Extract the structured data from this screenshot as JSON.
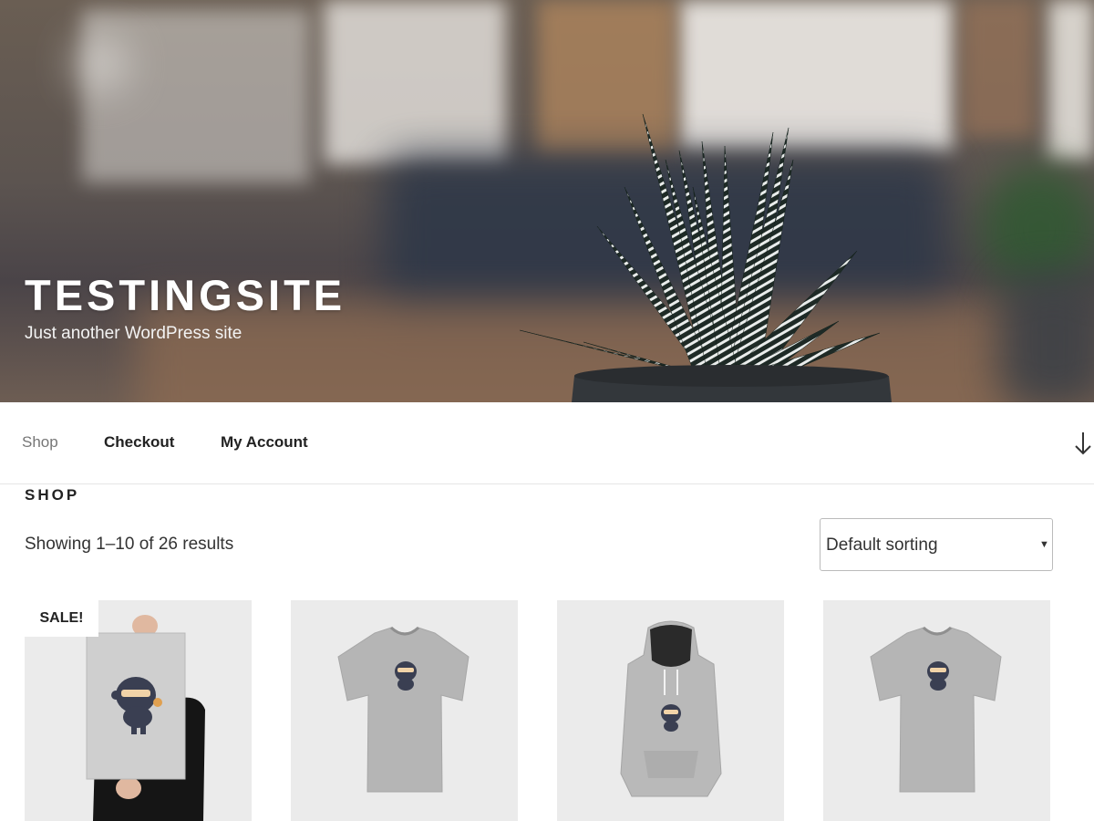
{
  "site": {
    "title": "TESTINGSITE",
    "tagline": "Just another WordPress site"
  },
  "nav": {
    "items": [
      {
        "label": "Shop",
        "current": true
      },
      {
        "label": "Checkout",
        "current": false
      },
      {
        "label": "My Account",
        "current": false
      }
    ],
    "scroll_icon": "arrow-down-icon"
  },
  "shop": {
    "title": "SHOP",
    "result_count": "Showing 1–10 of 26 results",
    "sorting": {
      "selected": "Default sorting",
      "caret_icon": "caret-down-icon"
    },
    "sale_badge": "SALE!",
    "products": [
      {
        "image": "poster-ninja-image",
        "on_sale": true
      },
      {
        "image": "tshirt-ninja-image",
        "on_sale": false
      },
      {
        "image": "hoodie-ninja-image",
        "on_sale": false
      },
      {
        "image": "tshirt-ninja-image",
        "on_sale": false
      }
    ]
  },
  "colors": {
    "text": "#222222",
    "nav_current": "#767676",
    "product_bg": "#ebebeb",
    "divider": "#e5e5e5"
  }
}
